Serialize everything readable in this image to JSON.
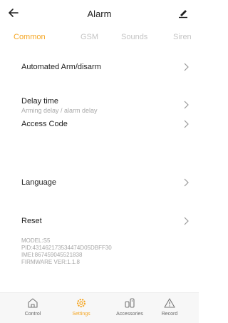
{
  "header": {
    "title": "Alarm",
    "back_icon": "arrow-left-icon",
    "edit_icon": "pencil-icon"
  },
  "tabs": [
    {
      "label": "Common",
      "active": true
    },
    {
      "label": "GSM",
      "active": false
    },
    {
      "label": "Sounds",
      "active": false
    },
    {
      "label": "Siren",
      "active": false
    }
  ],
  "settings": {
    "automated": {
      "label": "Automated Arm/disarm"
    },
    "delay": {
      "label": "Delay time",
      "subtitle": "Arming delay / alarm delay"
    },
    "access": {
      "label": "Access Code"
    },
    "language": {
      "label": "Language"
    },
    "reset": {
      "label": "Reset"
    }
  },
  "device_info": {
    "model": "MODEL:S5",
    "pid": "PID:431462173534474D05DBFF30",
    "imei": "IMEI:867459045521838",
    "firmware": "FIRMWARE VER:1.1.8"
  },
  "bottom_nav": [
    {
      "label": "Control",
      "icon": "home-icon",
      "active": false
    },
    {
      "label": "Settings",
      "icon": "gear-icon",
      "active": true
    },
    {
      "label": "Accessories",
      "icon": "sensor-icon",
      "active": false
    },
    {
      "label": "Record",
      "icon": "warning-icon",
      "active": false
    }
  ],
  "colors": {
    "accent": "#f5a623",
    "text": "#222222",
    "muted": "#a9a9a9",
    "tab_inactive": "#c4c4c4",
    "nav_background": "#f7f7f7"
  }
}
